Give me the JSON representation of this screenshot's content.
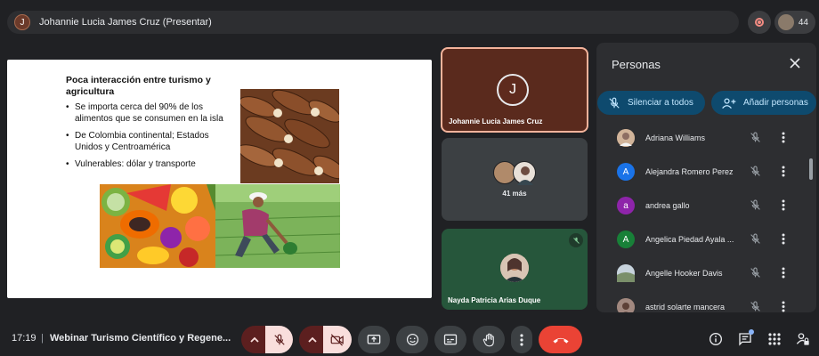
{
  "top_bar": {
    "presenter_initial": "J",
    "presenter_label": "Johannie Lucia James Cruz (Presentar)",
    "participant_count": "44"
  },
  "slide": {
    "title": "Poca interacción entre turismo y agricultura",
    "bullets": [
      "Se importa cerca del 90% de los alimentos que se consumen en la isla",
      "De Colombia continental; Estados Unidos y Centroamérica",
      "Vulnerables: dólar y transporte"
    ]
  },
  "tiles": [
    {
      "name": "Johannie Lucia James Cruz",
      "initial": "J"
    },
    {
      "label": "41 más"
    },
    {
      "name": "Nayda Patricia Arias Duque"
    }
  ],
  "panel": {
    "title": "Personas",
    "mute_all_label": "Silenciar a todos",
    "add_people_label": "Añadir personas",
    "people": [
      {
        "name": "Adriana Williams",
        "initial": "",
        "color": "#b38b6d"
      },
      {
        "name": "Alejandra Romero Perez",
        "initial": "A",
        "color": "#1a73e8"
      },
      {
        "name": "andrea gallo",
        "initial": "a",
        "color": "#8e24aa"
      },
      {
        "name": "Angelica Piedad Ayala ...",
        "initial": "A",
        "color": "#188038"
      },
      {
        "name": "Angelle Hooker Davis",
        "initial": "",
        "color": "#7c8a99"
      },
      {
        "name": "astrid solarte mancera",
        "initial": "",
        "color": "#8a6f5a"
      }
    ]
  },
  "bottom_bar": {
    "time": "17:19",
    "separator": "|",
    "meeting_title": "Webinar Turismo Científico y Regene..."
  }
}
